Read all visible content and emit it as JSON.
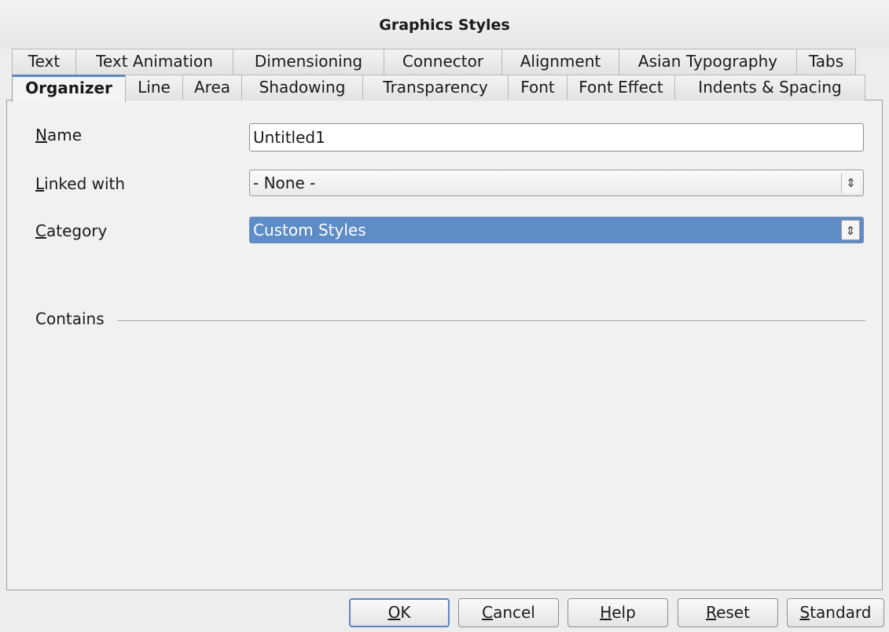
{
  "dialog": {
    "title": "Graphics Styles"
  },
  "tabs_back": [
    "Text",
    "Text Animation",
    "Dimensioning",
    "Connector",
    "Alignment",
    "Asian Typography",
    "Tabs"
  ],
  "tabs_front": [
    "Organizer",
    "Line",
    "Area",
    "Shadowing",
    "Transparency",
    "Font",
    "Font Effect",
    "Indents & Spacing"
  ],
  "active_tab": "Organizer",
  "form": {
    "name_label_key": "N",
    "name_label_rest": "ame",
    "name_value": "Untitled1",
    "linked_label_key": "L",
    "linked_label_rest": "inked with",
    "linked_value": "- None -",
    "category_label_key": "C",
    "category_label_rest": "ategory",
    "category_value": "Custom Styles",
    "contains_label": "Contains"
  },
  "buttons": {
    "ok_key": "O",
    "ok_rest": "K",
    "cancel_key": "C",
    "cancel_rest": "ancel",
    "help_key": "H",
    "help_rest": "elp",
    "reset_key": "R",
    "reset_rest": "eset",
    "standard_key": "S",
    "standard_rest": "tandard"
  },
  "icons": {
    "spin": "up-down-arrows-icon"
  }
}
